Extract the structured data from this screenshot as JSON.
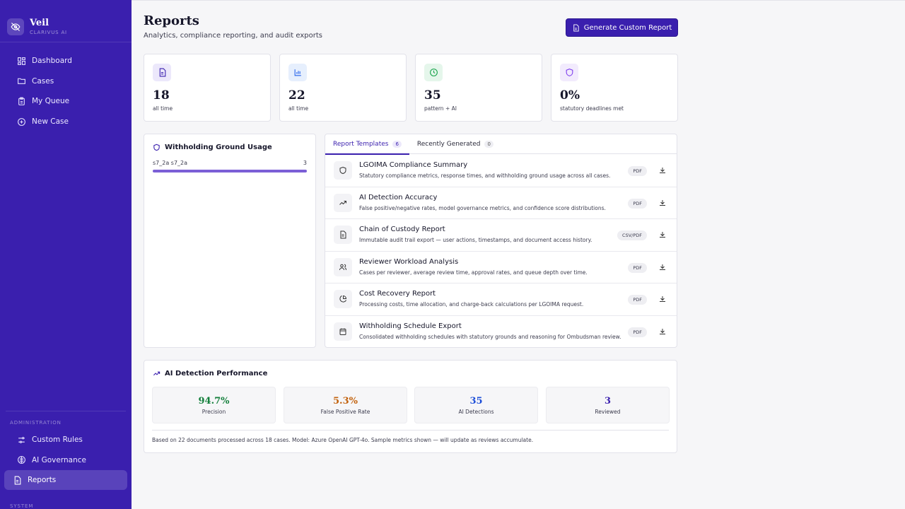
{
  "brand": {
    "name": "Veil",
    "subtitle": "CLARIVUS AI"
  },
  "nav": {
    "items": [
      {
        "label": "Dashboard",
        "icon": "grid-icon"
      },
      {
        "label": "Cases",
        "icon": "folder-icon"
      },
      {
        "label": "My Queue",
        "icon": "clipboard-icon"
      },
      {
        "label": "New Case",
        "icon": "plus-circle-icon"
      }
    ],
    "admin_label": "ADMINISTRATION",
    "admin_items": [
      {
        "label": "Custom Rules",
        "icon": "sliders-icon"
      },
      {
        "label": "AI Governance",
        "icon": "brain-icon"
      },
      {
        "label": "Reports",
        "icon": "document-icon",
        "active": true
      }
    ],
    "system_label": "SYSTEM"
  },
  "header": {
    "title": "Reports",
    "subtitle": "Analytics, compliance reporting, and audit exports",
    "generate_button": "Generate Custom Report"
  },
  "stats": [
    {
      "value": "18",
      "label": "all time",
      "icon": "document-icon",
      "color": "#3a1fae"
    },
    {
      "value": "22",
      "label": "all time",
      "icon": "bar-chart-icon",
      "color": "#2563eb"
    },
    {
      "value": "35",
      "label": "pattern + AI",
      "icon": "clock-icon",
      "color": "#16a34a"
    },
    {
      "value": "0%",
      "label": "statutory deadlines met",
      "icon": "shield-icon",
      "color": "#7c3aed"
    }
  ],
  "usage": {
    "title": "Withholding Ground Usage",
    "rows": [
      {
        "label": "s7_2a s7_2a",
        "count": "3",
        "fraction": 1.0
      }
    ]
  },
  "templates": {
    "tabs": [
      {
        "label": "Report Templates",
        "count": "6",
        "active": true
      },
      {
        "label": "Recently Generated",
        "count": "0",
        "active": false
      }
    ],
    "rows": [
      {
        "title": "LGOIMA Compliance Summary",
        "desc": "Statutory compliance metrics, response times, and withholding ground usage across all cases.",
        "format": "PDF",
        "icon": "shield-icon"
      },
      {
        "title": "AI Detection Accuracy",
        "desc": "False positive/negative rates, model governance metrics, and confidence score distributions.",
        "format": "PDF",
        "icon": "trending-up-icon"
      },
      {
        "title": "Chain of Custody Report",
        "desc": "Immutable audit trail export — user actions, timestamps, and document access history.",
        "format": "CSV/PDF",
        "icon": "document-icon"
      },
      {
        "title": "Reviewer Workload Analysis",
        "desc": "Cases per reviewer, average review time, approval rates, and queue depth over time.",
        "format": "PDF",
        "icon": "users-icon"
      },
      {
        "title": "Cost Recovery Report",
        "desc": "Processing costs, time allocation, and charge-back calculations per LGOIMA request.",
        "format": "PDF",
        "icon": "pie-chart-icon"
      },
      {
        "title": "Withholding Schedule Export",
        "desc": "Consolidated withholding schedules with statutory grounds and reasoning for Ombudsman review.",
        "format": "PDF",
        "icon": "calendar-icon"
      }
    ]
  },
  "performance": {
    "title": "AI Detection Performance",
    "metrics": [
      {
        "value": "94.7%",
        "label": "Precision",
        "color": "#15803d"
      },
      {
        "value": "5.3%",
        "label": "False Positive Rate",
        "color": "#c2610c"
      },
      {
        "value": "35",
        "label": "AI Detections",
        "color": "#1d4ed8"
      },
      {
        "value": "3",
        "label": "Reviewed",
        "color": "#3a1fae"
      }
    ],
    "note": "Based on 22 documents processed across 18 cases. Model: Azure OpenAI GPT-4o. Sample metrics shown — will update as reviews accumulate."
  }
}
